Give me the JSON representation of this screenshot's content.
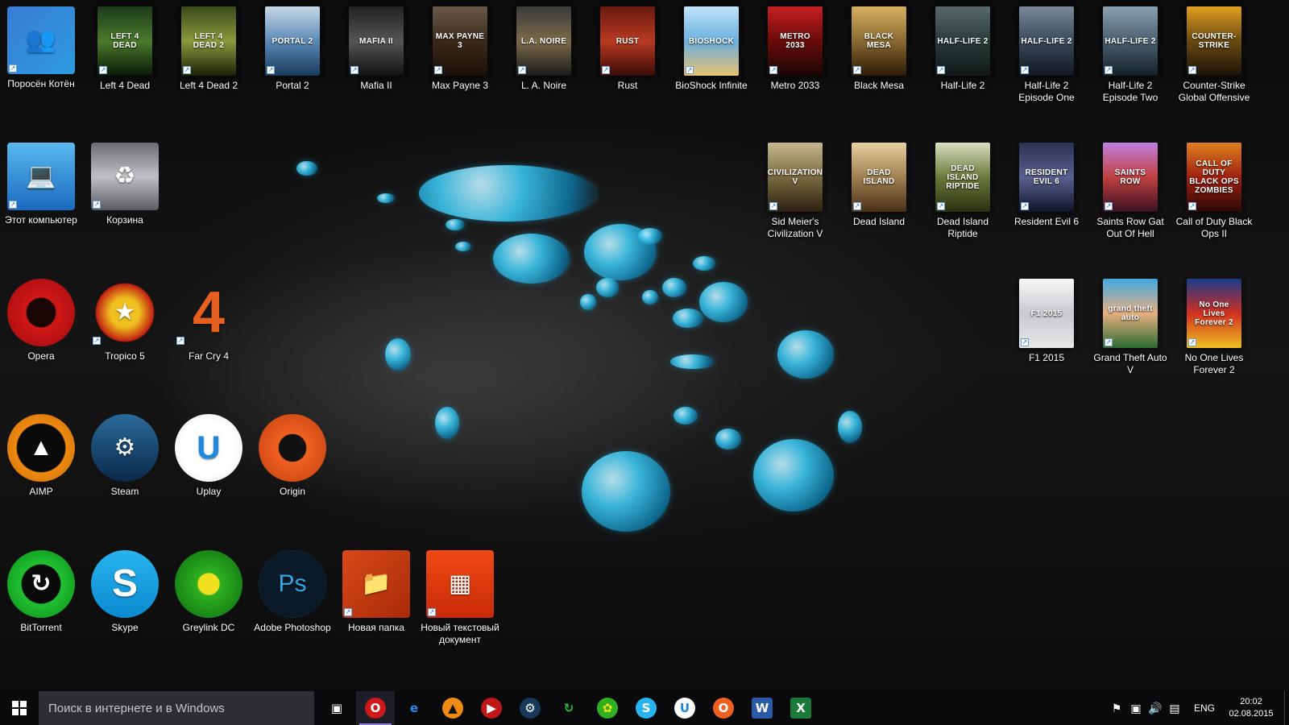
{
  "desktop": {
    "icons": [
      {
        "label": "Поросён Котён",
        "icon": "user-account-icon"
      },
      {
        "label": "Left 4 Dead",
        "icon": "left4dead-cover-icon",
        "cover_text": "LEFT 4 DEAD"
      },
      {
        "label": "Left 4 Dead 2",
        "icon": "left4dead2-cover-icon",
        "cover_text": "LEFT 4 DEAD 2"
      },
      {
        "label": "Portal 2",
        "icon": "portal2-cover-icon",
        "cover_text": "PORTAL 2"
      },
      {
        "label": "Mafia II",
        "icon": "mafia2-cover-icon",
        "cover_text": "MAFIA II"
      },
      {
        "label": "Max Payne 3",
        "icon": "maxpayne3-cover-icon",
        "cover_text": "MAX PAYNE 3"
      },
      {
        "label": "L. A. Noire",
        "icon": "lanoire-cover-icon",
        "cover_text": "L.A. NOIRE"
      },
      {
        "label": "Rust",
        "icon": "rust-cover-icon",
        "cover_text": "RUST"
      },
      {
        "label": "BioShock Infinite",
        "icon": "bioshock-cover-icon",
        "cover_text": "BIOSHOCK"
      },
      {
        "label": "Metro 2033",
        "icon": "metro2033-cover-icon",
        "cover_text": "METRO 2033"
      },
      {
        "label": "Black Mesa",
        "icon": "blackmesa-cover-icon",
        "cover_text": "BLACK MESA"
      },
      {
        "label": "Half-Life 2",
        "icon": "halflife2-cover-icon",
        "cover_text": "HALF-LIFE 2"
      },
      {
        "label": "Half-Life 2 Episode One",
        "icon": "hl2ep1-cover-icon",
        "cover_text": "HALF-LIFE 2"
      },
      {
        "label": "Half-Life 2 Episode Two",
        "icon": "hl2ep2-cover-icon",
        "cover_text": "HALF-LIFE 2"
      },
      {
        "label": "Counter-Strike Global Offensive",
        "icon": "csgo-cover-icon",
        "cover_text": "COUNTER-STRIKE"
      },
      {
        "label": "Этот компьютер",
        "icon": "this-pc-icon"
      },
      {
        "label": "Корзина",
        "icon": "recycle-bin-icon"
      },
      {
        "label": "Sid Meier's Civilization V",
        "icon": "civilization5-cover-icon",
        "cover_text": "CIVILIZATION V"
      },
      {
        "label": "Dead Island",
        "icon": "deadisland-cover-icon",
        "cover_text": "DEAD ISLAND"
      },
      {
        "label": "Dead Island Riptide",
        "icon": "deadisland-riptide-cover-icon",
        "cover_text": "DEAD ISLAND RIPTIDE"
      },
      {
        "label": "Resident Evil 6",
        "icon": "residentevil6-cover-icon",
        "cover_text": "RESIDENT EVIL 6"
      },
      {
        "label": "Saints Row Gat Out Of Hell",
        "icon": "saintsrow-cover-icon",
        "cover_text": "SAINTS ROW"
      },
      {
        "label": "Call of Duty Black Ops II",
        "icon": "codbo2-cover-icon",
        "cover_text": "CALL OF DUTY BLACK OPS ZOMBIES"
      },
      {
        "label": "Opera",
        "icon": "opera-icon"
      },
      {
        "label": "Tropico 5",
        "icon": "tropico5-icon"
      },
      {
        "label": "Far Cry 4",
        "icon": "farcry4-icon",
        "cover_text": "4"
      },
      {
        "label": "F1 2015",
        "icon": "f1-2015-cover-icon",
        "cover_text": "F1 2015"
      },
      {
        "label": "Grand Theft Auto V",
        "icon": "gta5-cover-icon",
        "cover_text": "grand theft auto"
      },
      {
        "label": "No One Lives Forever 2",
        "icon": "nolf2-cover-icon",
        "cover_text": "No One Lives Forever 2"
      },
      {
        "label": "AIMP",
        "icon": "aimp-icon"
      },
      {
        "label": "Steam",
        "icon": "steam-icon"
      },
      {
        "label": "Uplay",
        "icon": "uplay-icon"
      },
      {
        "label": "Origin",
        "icon": "origin-icon"
      },
      {
        "label": "BitTorrent",
        "icon": "bittorrent-icon"
      },
      {
        "label": "Skype",
        "icon": "skype-icon"
      },
      {
        "label": "Greylink DC",
        "icon": "greylink-dc-icon"
      },
      {
        "label": "Adobe Photoshop",
        "icon": "photoshop-icon",
        "cover_text": "Ps"
      },
      {
        "label": "Новая папка",
        "icon": "folder-icon"
      },
      {
        "label": "Новый текстовый документ",
        "icon": "office-document-icon"
      }
    ]
  },
  "taskbar": {
    "search_placeholder": "Поиск в интернете и в Windows",
    "pinned": [
      {
        "name": "task-view",
        "icon": "task-view-icon"
      },
      {
        "name": "opera",
        "icon": "opera-icon",
        "active": true
      },
      {
        "name": "edge",
        "icon": "edge-icon"
      },
      {
        "name": "aimp",
        "icon": "aimp-icon"
      },
      {
        "name": "youtube",
        "icon": "youtube-icon"
      },
      {
        "name": "steam",
        "icon": "steam-icon"
      },
      {
        "name": "bittorrent",
        "icon": "bittorrent-icon"
      },
      {
        "name": "greylink",
        "icon": "greylink-dc-icon"
      },
      {
        "name": "skype",
        "icon": "skype-icon"
      },
      {
        "name": "uplay",
        "icon": "uplay-icon"
      },
      {
        "name": "origin",
        "icon": "origin-icon"
      },
      {
        "name": "word",
        "icon": "word-icon"
      },
      {
        "name": "excel",
        "icon": "excel-icon"
      }
    ],
    "tray": {
      "language": "ENG",
      "time": "20:02",
      "date": "02.08.2015"
    }
  }
}
